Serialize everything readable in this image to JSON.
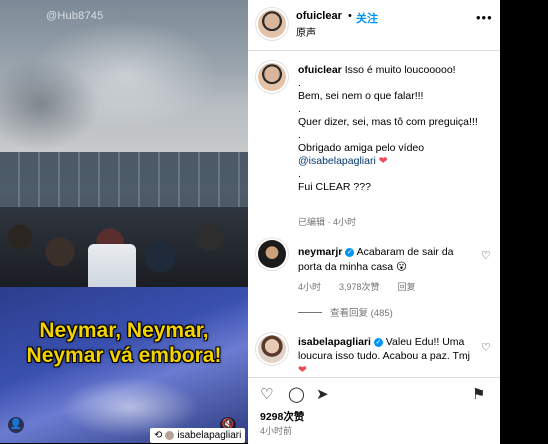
{
  "media": {
    "watermark": "@Hub8745",
    "caption_line1": "Neymar, Neymar,",
    "caption_line2": "Neymar vá embora!",
    "repost_user": "isabelapagliari"
  },
  "post": {
    "username": "ofuiclear",
    "separator": "•",
    "follow_label": "关注",
    "audio_label": "原声",
    "more_icon": "more-horizontal-icon",
    "caption": {
      "username": "ofuiclear",
      "text": "Isso é muito loucooooo!",
      "lines": [
        ".",
        "Bem, sei nem o que falar!!!",
        ".",
        "Quer dizer, sei, mas tô com preguiça!!!",
        ".",
        "Obrigado amiga pelo vídeo"
      ],
      "mention": "@isabelapagliari",
      "heart": "❤",
      "dot2": ".",
      "last": "Fui CLEAR ???",
      "meta": "已编辑 · 4小时"
    },
    "comments": [
      {
        "username": "neymarjr",
        "text": "Acabaram de sair da porta da minha casa 😮",
        "meta_time": "4小时",
        "meta_likes": "3,978次赞",
        "meta_reply": "回复",
        "view_replies": "查看回复 (485)"
      },
      {
        "username": "isabelapagliari",
        "text": "Valeu Edu!! Uma loucura isso tudo. Acabou a paz. Tmj",
        "heart": "❤"
      }
    ],
    "likes": "9298次赞",
    "time": "4小时前"
  },
  "colors": {
    "accent": "#0095f6",
    "caption_yellow": "#f5d300",
    "heart": "#ed4956",
    "meta_gray": "#737373"
  }
}
